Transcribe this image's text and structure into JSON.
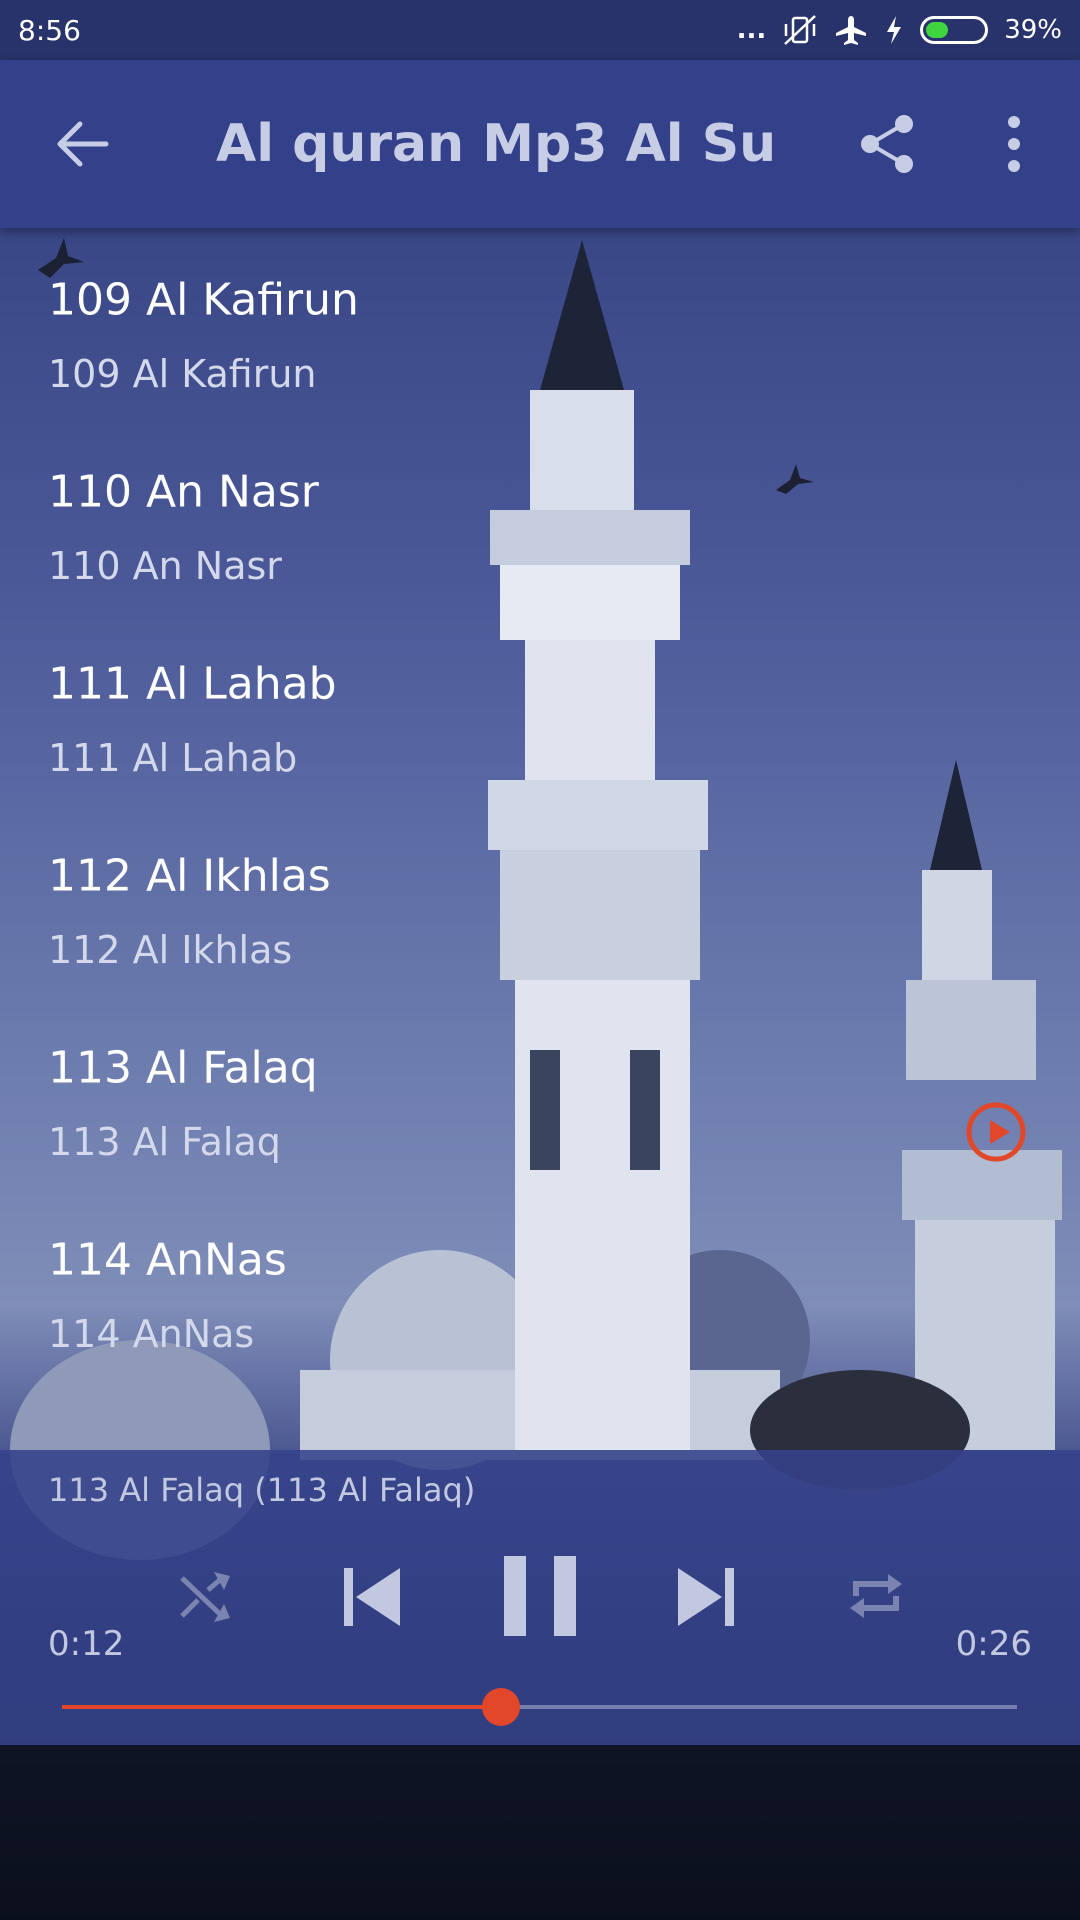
{
  "status_bar": {
    "time": "8:56",
    "dots": "...",
    "battery_percent": "39%",
    "battery_level": 0.39,
    "icons": [
      "vibrate-off-icon",
      "airplane-mode-icon",
      "charging-icon",
      "battery-icon"
    ]
  },
  "toolbar": {
    "title": "Al quran Mp3 Al Su...",
    "back_icon": "arrow-back-icon",
    "share_icon": "share-icon",
    "more_icon": "more-vert-icon"
  },
  "list": [
    {
      "title": "109 Al Kafirun",
      "subtitle": "109 Al Kafirun"
    },
    {
      "title": "110 An Nasr",
      "subtitle": "110 An Nasr"
    },
    {
      "title": "111 Al Lahab",
      "subtitle": "111 Al Lahab"
    },
    {
      "title": "112 Al Ikhlas",
      "subtitle": "112 Al Ikhlas"
    },
    {
      "title": "113 Al Falaq",
      "subtitle": "113 Al Falaq"
    },
    {
      "title": "114 AnNas",
      "subtitle": "114 AnNas"
    }
  ],
  "player": {
    "now_playing": "113 Al Falaq (113 Al Falaq)",
    "elapsed": "0:12",
    "duration": "0:26",
    "progress": 0.46,
    "controls": [
      "shuffle-icon",
      "skip-previous-icon",
      "pause-icon",
      "skip-next-icon",
      "repeat-icon"
    ]
  },
  "colors": {
    "accent": "#e2472a",
    "toolbar": "#33418a",
    "status_bar": "#27336a"
  }
}
